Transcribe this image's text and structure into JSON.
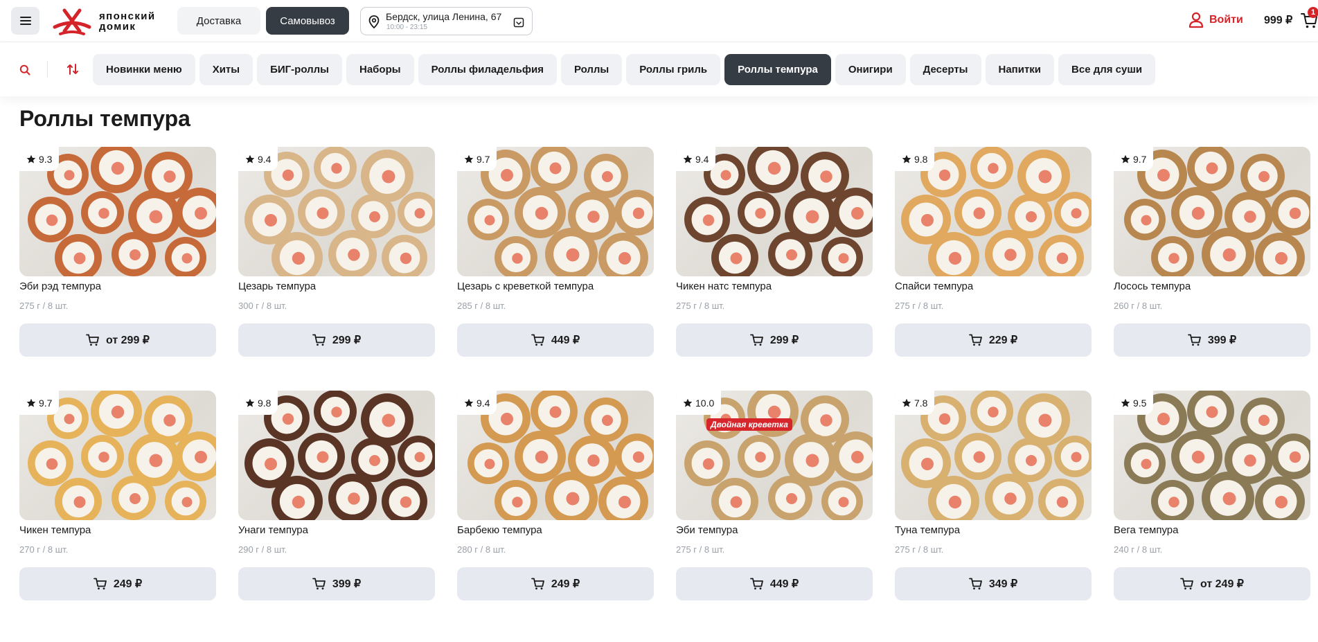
{
  "header": {
    "logo_text_line1": "японский",
    "logo_text_line2": "домик",
    "delivery_label": "Доставка",
    "pickup_label": "Самовывоз",
    "address_line": "Бердск, улица Ленина, 67",
    "address_hours": "10:00 - 23:15",
    "login_label": "Войти",
    "cart_total": "999 ₽",
    "cart_count": "1"
  },
  "colors": {
    "brand_red": "#d5232a",
    "dark_chip": "#353c44",
    "chip_bg": "#f0f1f4",
    "button_bg": "#e6e9ef"
  },
  "categories": [
    {
      "label": "Новинки меню"
    },
    {
      "label": "Хиты"
    },
    {
      "label": "БИГ-роллы"
    },
    {
      "label": "Наборы"
    },
    {
      "label": "Роллы филадельфия"
    },
    {
      "label": "Роллы"
    },
    {
      "label": "Роллы гриль"
    },
    {
      "label": "Роллы темпура",
      "active": true
    },
    {
      "label": "Онигири"
    },
    {
      "label": "Десерты"
    },
    {
      "label": "Напитки"
    },
    {
      "label": "Все для суши"
    }
  ],
  "page_title": "Роллы темпура",
  "products": [
    {
      "rating": "9.3",
      "name": "Эби рэд темпура",
      "weight": "275 г / 8 шт.",
      "price": "от 299 ₽",
      "tint": "#c76a3a"
    },
    {
      "rating": "9.4",
      "name": "Цезарь темпура",
      "weight": "300 г / 8 шт.",
      "price": "299 ₽",
      "tint": "#d9b68a"
    },
    {
      "rating": "9.7",
      "name": "Цезарь с креветкой темпура",
      "weight": "285 г / 8 шт.",
      "price": "449 ₽",
      "tint": "#c99a63"
    },
    {
      "rating": "9.4",
      "name": "Чикен натс темпура",
      "weight": "275 г / 8 шт.",
      "price": "299 ₽",
      "tint": "#6e4630"
    },
    {
      "rating": "9.8",
      "name": "Спайси темпура",
      "weight": "275 г / 8 шт.",
      "price": "229 ₽",
      "tint": "#e0a95f"
    },
    {
      "rating": "9.7",
      "name": "Лосось темпура",
      "weight": "260 г / 8 шт.",
      "price": "399 ₽",
      "tint": "#b88750"
    },
    {
      "rating": "9.7",
      "name": "Чикен темпура",
      "weight": "270 г / 8 шт.",
      "price": "249 ₽",
      "tint": "#e6b35a"
    },
    {
      "rating": "9.8",
      "name": "Унаги темпура",
      "weight": "290 г / 8 шт.",
      "price": "399 ₽",
      "tint": "#5a3424"
    },
    {
      "rating": "9.4",
      "name": "Барбекю темпура",
      "weight": "280 г / 8 шт.",
      "price": "249 ₽",
      "tint": "#d49a52"
    },
    {
      "rating": "10.0",
      "name": "Эби темпура",
      "weight": "275 г / 8 шт.",
      "price": "449 ₽",
      "tint": "#c9a36e",
      "promo": "Двойная креветка"
    },
    {
      "rating": "7.8",
      "name": "Туна темпура",
      "weight": "275 г / 8 шт.",
      "price": "349 ₽",
      "tint": "#d8b070"
    },
    {
      "rating": "9.5",
      "name": "Вега темпура",
      "weight": "240 г / 8 шт.",
      "price": "от 249 ₽",
      "tint": "#8a7a55"
    }
  ]
}
